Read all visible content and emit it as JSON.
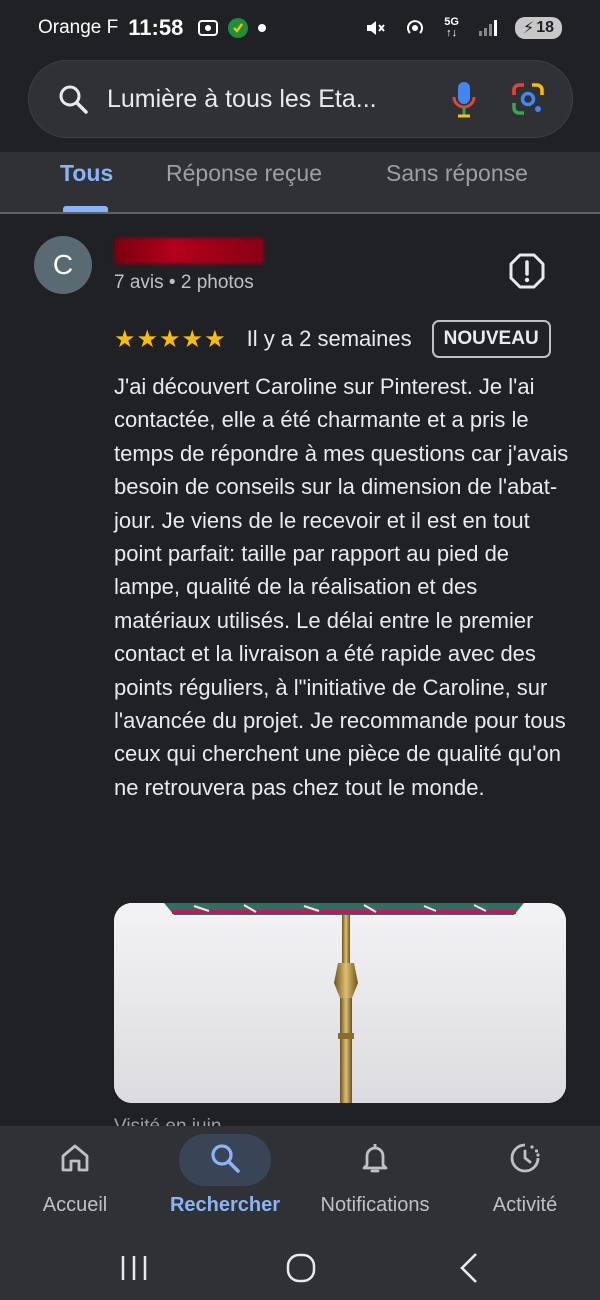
{
  "status_bar": {
    "carrier": "Orange F",
    "time": "11:58",
    "network": "5G",
    "battery": "18"
  },
  "search": {
    "query": "Lumière à tous les Eta..."
  },
  "tabs": [
    {
      "label": "Tous",
      "active": true
    },
    {
      "label": "Réponse reçue",
      "active": false
    },
    {
      "label": "Sans réponse",
      "active": false
    }
  ],
  "review": {
    "avatar_letter": "C",
    "reviewer_meta": "7 avis • 2 photos",
    "stars": "★★★★★",
    "rating": 5,
    "date": "Il y a 2 semaines",
    "badge": "NOUVEAU",
    "text": "J'ai découvert Caroline sur Pinterest. Je l'ai contactée, elle a été charmante et a pris le temps de répondre à mes questions car j'avais besoin de conseils sur la dimension de l'abat-jour. Je viens de le recevoir et il est en tout point parfait: taille par rapport au pied de lampe, qualité de la réalisation et des matériaux utilisés. Le délai entre le premier contact et la livraison a été rapide avec des points réguliers, à l\"initiative de Caroline, sur l'avancée du projet. Je recommande pour tous ceux qui cherchent une pièce de qualité qu'on ne retrouvera pas chez tout le monde.",
    "visited_partial": "Visité en juin"
  },
  "bottom_nav": [
    {
      "label": "Accueil",
      "icon": "home-icon",
      "active": false
    },
    {
      "label": "Rechercher",
      "icon": "search-icon",
      "active": true
    },
    {
      "label": "Notifications",
      "icon": "bell-icon",
      "active": false
    },
    {
      "label": "Activité",
      "icon": "history-icon",
      "active": false
    }
  ],
  "colors": {
    "accent": "#8ab4f8",
    "star": "#fbbc04",
    "background": "#202124"
  }
}
